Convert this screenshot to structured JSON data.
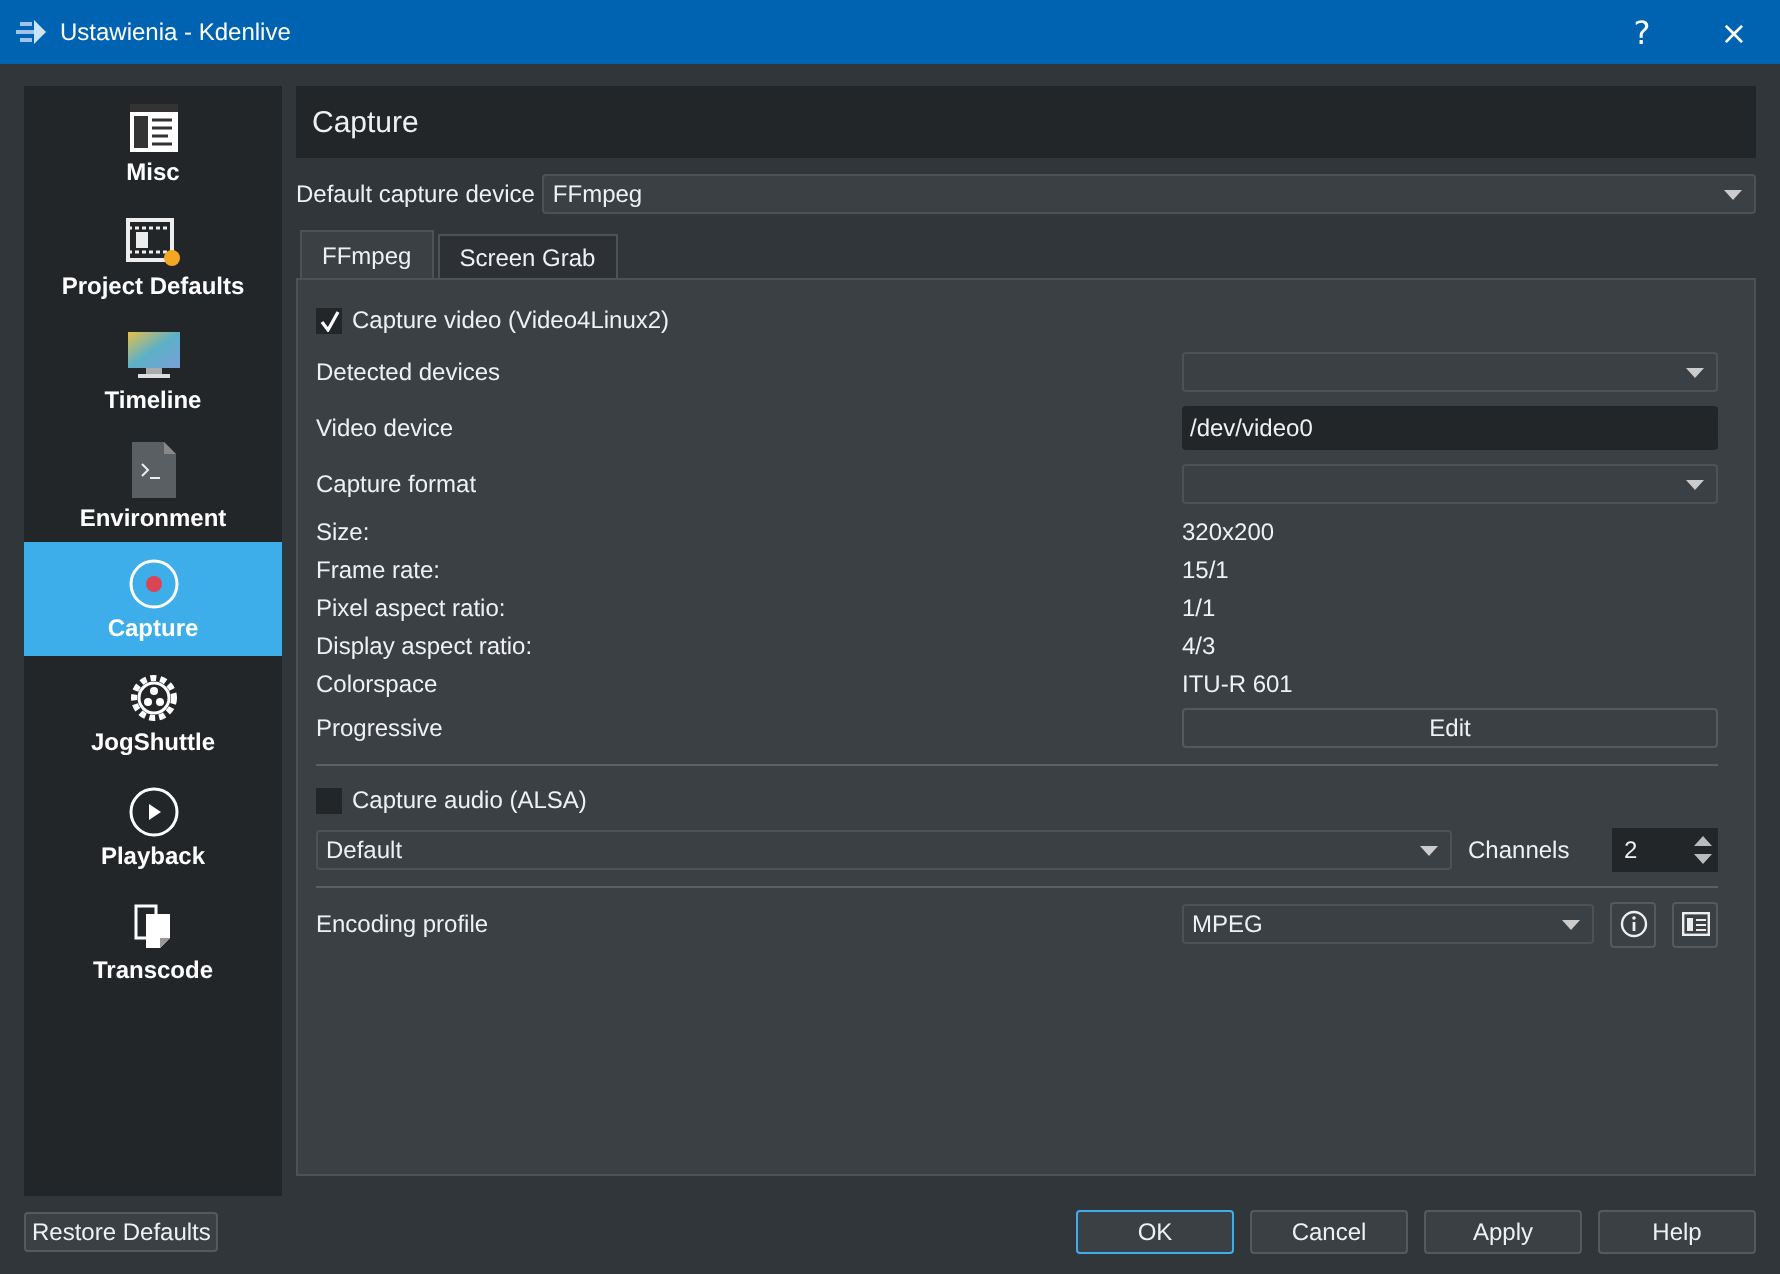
{
  "window": {
    "title": "Ustawienia - Kdenlive",
    "buttons": [
      "?",
      "×"
    ]
  },
  "sidebar": {
    "items": [
      {
        "label": "Misc",
        "kind": "misc",
        "selected": false
      },
      {
        "label": "Project Defaults",
        "kind": "film",
        "selected": false
      },
      {
        "label": "Timeline",
        "kind": "monitor",
        "selected": false
      },
      {
        "label": "Environment",
        "kind": "terminal",
        "selected": false
      },
      {
        "label": "Capture",
        "kind": "record",
        "selected": true
      },
      {
        "label": "JogShuttle",
        "kind": "gear",
        "selected": false
      },
      {
        "label": "Playback",
        "kind": "play",
        "selected": false
      },
      {
        "label": "Transcode",
        "kind": "copy",
        "selected": false
      }
    ]
  },
  "page_title": "Capture",
  "default_device": {
    "label": "Default capture device",
    "value": "FFmpeg"
  },
  "tabs": [
    {
      "label": "FFmpeg",
      "selected": true
    },
    {
      "label": "Screen Grab",
      "selected": false
    }
  ],
  "video": {
    "checkbox": {
      "label": "Capture video (Video4Linux2)",
      "checked": true
    },
    "rows": [
      {
        "kind": "combo",
        "label": "Detected devices"
      },
      {
        "kind": "input",
        "label": "Video device",
        "value": "/dev/video0"
      },
      {
        "kind": "combo",
        "label": "Capture format"
      },
      {
        "kind": "info",
        "label": "Size:",
        "value": "320x200"
      },
      {
        "kind": "info",
        "label": "Frame rate:",
        "value": "15/1"
      },
      {
        "kind": "info",
        "label": "Pixel aspect ratio:",
        "value": "1/1"
      },
      {
        "kind": "info",
        "label": "Display aspect ratio:",
        "value": "4/3"
      },
      {
        "kind": "info",
        "label": "Colorspace",
        "value": "ITU-R 601"
      },
      {
        "kind": "button",
        "label": "Progressive",
        "button": "Edit"
      }
    ]
  },
  "audio": {
    "checkbox": {
      "label": "Capture audio (ALSA)",
      "checked": false
    },
    "device": "Default",
    "channels_label": "Channels",
    "channels": "2"
  },
  "encoding": {
    "label": "Encoding profile",
    "value": "MPEG"
  },
  "restore": "Restore Defaults",
  "buttons": [
    {
      "label": "OK",
      "default": true
    },
    {
      "label": "Cancel",
      "default": false
    },
    {
      "label": "Apply",
      "default": false
    },
    {
      "label": "Help",
      "default": false
    }
  ]
}
